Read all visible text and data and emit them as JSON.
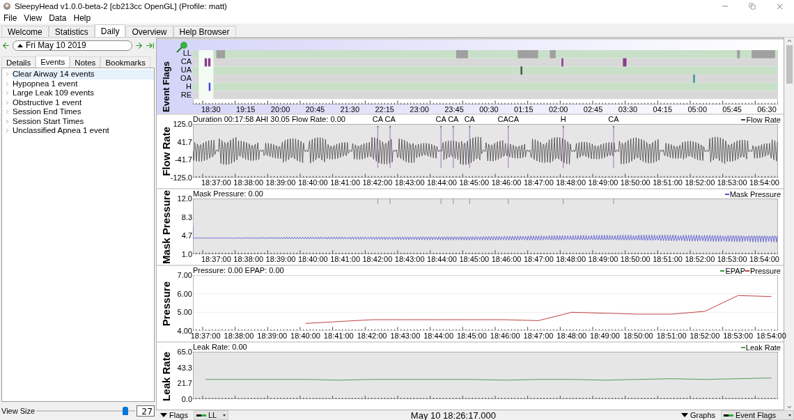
{
  "window": {
    "title": "SleepyHead v1.0.0-beta-2 [cb213cc OpenGL] (Profile: matt)"
  },
  "menu": [
    "File",
    "View",
    "Data",
    "Help"
  ],
  "tabs": [
    {
      "label": "Welcome",
      "selected": false
    },
    {
      "label": "Statistics",
      "selected": false
    },
    {
      "label": "Daily",
      "selected": true
    },
    {
      "label": "Overview",
      "selected": false
    },
    {
      "label": "Help Browser",
      "selected": false
    }
  ],
  "date_nav": {
    "date": "Fri May 10 2019"
  },
  "subtabs": [
    {
      "label": "Details",
      "selected": false
    },
    {
      "label": "Events",
      "selected": true
    },
    {
      "label": "Notes",
      "selected": false
    },
    {
      "label": "Bookmarks",
      "selected": false
    }
  ],
  "events": [
    {
      "label": "Clear Airway 14 events",
      "selected": true,
      "expanded": false
    },
    {
      "label": "Hypopnea 1 event",
      "selected": false,
      "expanded": false
    },
    {
      "label": "Large Leak 109 events",
      "selected": false,
      "expanded": false
    },
    {
      "label": "Obstructive 1 event",
      "selected": false,
      "expanded": false
    },
    {
      "label": "Session End Times",
      "selected": false,
      "expanded": false
    },
    {
      "label": "Session Start Times",
      "selected": false,
      "expanded": false
    },
    {
      "label": "Unclassified Apnea 1 event",
      "selected": false,
      "expanded": false
    }
  ],
  "view_size": {
    "label": "View Size",
    "level": 0.9,
    "value": "27"
  },
  "event_flags": {
    "title": "Event Flags",
    "rows": [
      {
        "label": "LL",
        "color": "#a0a0a0"
      },
      {
        "label": "CA",
        "color": "#8a3a8a"
      },
      {
        "label": "UA",
        "color": "#505050"
      },
      {
        "label": "OA",
        "color": "#3a9a9a"
      },
      {
        "label": "H",
        "color": "#4a4ad0"
      },
      {
        "label": "RE"
      }
    ],
    "x_ticks": [
      "18:30",
      "19:15",
      "20:00",
      "20:45",
      "21:30",
      "22:15",
      "23:00",
      "23:45",
      "00:30",
      "01:15",
      "02:00",
      "02:45",
      "03:30",
      "04:15",
      "05:00",
      "05:45",
      "06:30"
    ]
  },
  "graphs": [
    {
      "kind": "waveform",
      "title": "Flow Rate",
      "info": "Duration 00:17:58 AHI 30.05 Flow Rate: 0.00",
      "legend": [
        {
          "label": "Flow Rate",
          "color": "#404040"
        }
      ],
      "y_ticks": [
        "125.0",
        "41.7",
        "-41.7",
        "-125.0"
      ],
      "x_ticks": [
        "18:37:00",
        "18:38:00",
        "18:39:00",
        "18:40:00",
        "18:41:00",
        "18:42:00",
        "18:43:00",
        "18:44:00",
        "18:45:00",
        "18:46:00",
        "18:47:00",
        "18:48:00",
        "18:49:00",
        "18:50:00",
        "18:51:00",
        "18:52:00",
        "18:53:00",
        "18:54:00"
      ],
      "markers": [
        "CA",
        "CA",
        "CA",
        "CA",
        "CA",
        "CACA",
        "H",
        "CA"
      ]
    },
    {
      "kind": "waveform",
      "title": "Mask Pressure",
      "info": "Mask Pressure: 0.00",
      "legend": [
        {
          "label": "Mask Pressure",
          "color": "#5050d0"
        }
      ],
      "y_ticks": [
        "12.0",
        "8.3",
        "4.7",
        "1.0"
      ],
      "x_ticks": [
        "18:37:00",
        "18:38:00",
        "18:39:00",
        "18:40:00",
        "18:41:00",
        "18:42:00",
        "18:43:00",
        "18:44:00",
        "18:45:00",
        "18:46:00",
        "18:47:00",
        "18:48:00",
        "18:49:00",
        "18:50:00",
        "18:51:00",
        "18:52:00",
        "18:53:00",
        "18:54:00"
      ]
    },
    {
      "kind": "chart",
      "title": "Pressure",
      "info": "Pressure: 0.00 EPAP: 0.00",
      "chart_data": {
        "type": "line",
        "categories": [
          "18:37:00",
          "18:38:00",
          "18:39:00",
          "18:40:00",
          "18:41:00",
          "18:42:00",
          "18:43:00",
          "18:44:00",
          "18:45:00",
          "18:46:00",
          "18:47:00",
          "18:48:00",
          "18:49:00",
          "18:50:00",
          "18:51:00",
          "18:52:00",
          "18:53:00",
          "18:54:00"
        ],
        "series": [
          {
            "name": "EPAP",
            "color": "#3a9a3a",
            "values": [
              null,
              null,
              null,
              null,
              null,
              null,
              null,
              null,
              null,
              null,
              null,
              null,
              null,
              null,
              null,
              null,
              null,
              null
            ]
          },
          {
            "name": "Pressure",
            "color": "#c04040",
            "values": [
              null,
              null,
              null,
              4.4,
              4.5,
              4.6,
              4.6,
              4.6,
              4.6,
              4.6,
              4.55,
              5.0,
              4.95,
              4.9,
              4.9,
              5.05,
              5.9,
              5.85
            ]
          }
        ],
        "ylim": [
          4,
          7
        ],
        "yticks": [
          {
            "value": 7,
            "label": "7.00"
          },
          {
            "value": 6,
            "label": "6.00"
          },
          {
            "value": 5,
            "label": "5.00"
          },
          {
            "value": 4,
            "label": "4.00"
          }
        ]
      }
    },
    {
      "kind": "chart",
      "title": "Leak Rate",
      "info": "Leak Rate: 0.00",
      "chart_data": {
        "type": "line",
        "series": [
          {
            "name": "Leak Rate",
            "color": "#5a9a5a",
            "values": [
              27,
              27,
              27,
              27,
              26,
              27,
              27,
              27,
              27,
              26,
              27,
              27,
              26,
              27,
              28,
              27,
              28,
              29
            ]
          }
        ],
        "ylim": [
          0,
          65
        ],
        "yticks": [
          {
            "value": 65,
            "label": "65.0"
          },
          {
            "value": 43.3,
            "label": "43.3"
          },
          {
            "value": 21.7,
            "label": "21.7"
          },
          {
            "value": 0,
            "label": "0.0"
          }
        ]
      }
    }
  ],
  "status_bar": {
    "flags_button": "Flags",
    "flag_select": "LL",
    "time": "May 10 18:26:17.000",
    "graphs_button": "Graphs",
    "graph_select": "Event Flags"
  }
}
